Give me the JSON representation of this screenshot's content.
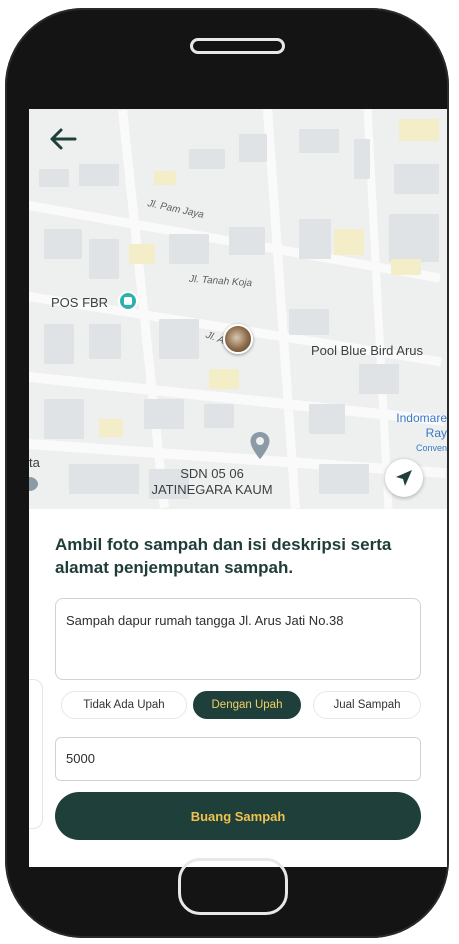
{
  "map": {
    "street_labels": [
      "Jl. Pam Jaya",
      "Jl. Tanah Koja",
      "Jl. Arus"
    ],
    "pois": {
      "pos_fbr": "POS FBR",
      "pool_bird": "Pool Blue Bird Arus",
      "indomaret": "Indomare",
      "indomaret_sub": "Ray",
      "indomaret_small": "Conven",
      "school_line1": "SDN 05 06",
      "school_line2": "JATINEGARA KAUM",
      "edge_text": "ta"
    }
  },
  "form": {
    "instructions": "Ambil foto sampah dan isi deskripsi serta alamat penjemputan sampah.",
    "description": "Sampah dapur rumah tangga Jl. Arus Jati No.38",
    "chips": [
      {
        "label": "Tidak Ada Upah",
        "active": false
      },
      {
        "label": "Dengan Upah",
        "active": true
      },
      {
        "label": "Jual Sampah",
        "active": false
      }
    ],
    "price": "5000",
    "submit_label": "Buang Sampah"
  },
  "colors": {
    "primary": "#1e3f3a",
    "accent": "#f0c24e",
    "poi_blue": "#3a77c8",
    "poi_teal": "#2bb3a8"
  },
  "icons": {
    "back": "arrow-left-icon",
    "location": "navigation-arrow-icon",
    "poi": "map-pin-icon"
  }
}
